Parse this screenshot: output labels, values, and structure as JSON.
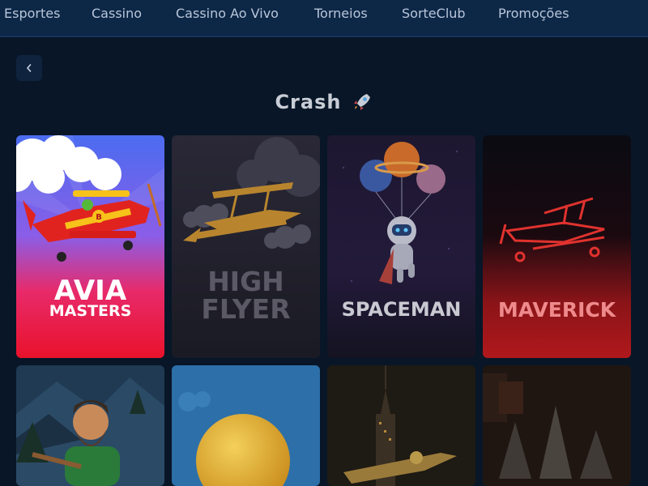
{
  "nav": {
    "items": [
      "Esportes",
      "Cassino",
      "Cassino Ao Vivo",
      "Torneios",
      "SorteClub",
      "Promoções"
    ]
  },
  "page": {
    "title": "Crash",
    "title_icon": "rocket-icon",
    "back_icon": "chevron-left-icon"
  },
  "games": [
    {
      "title_line1": "AVIA",
      "title_line2": "MASTERS",
      "theme": "avia-masters"
    },
    {
      "title_line1": "HIGH",
      "title_line2": "FLYER",
      "theme": "high-flyer"
    },
    {
      "title_line1": "SPACEMAN",
      "title_line2": "",
      "theme": "spaceman"
    },
    {
      "title_line1": "MAVERICK",
      "title_line2": "",
      "theme": "maverick"
    },
    {
      "title_line1": "",
      "title_line2": "",
      "theme": "lumberjack"
    },
    {
      "title_line1": "",
      "title_line2": "",
      "theme": "balloon"
    },
    {
      "title_line1": "",
      "title_line2": "",
      "theme": "city-plane"
    },
    {
      "title_line1": "",
      "title_line2": "",
      "theme": "jets"
    }
  ],
  "colors": {
    "background": "#081627",
    "nav_background": "#0d2747",
    "nav_text": "#b8c6d9",
    "title_text": "#c9ced6"
  }
}
